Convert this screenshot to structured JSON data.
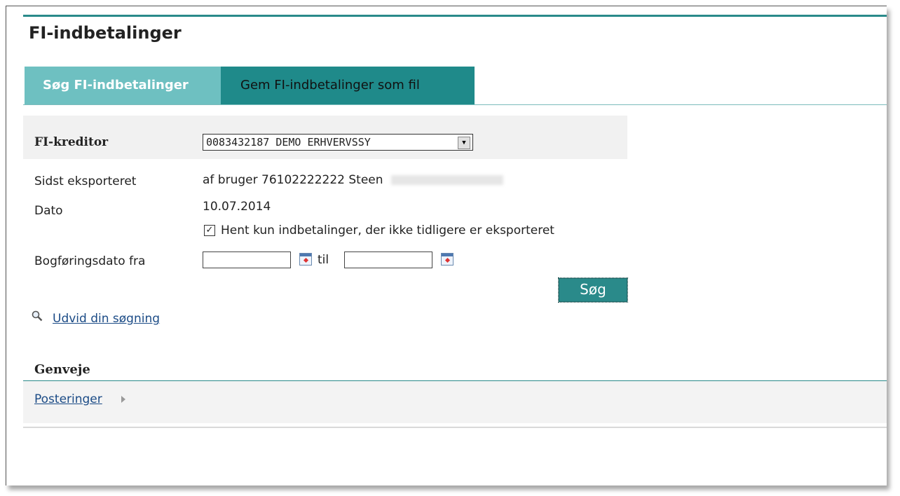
{
  "page": {
    "title": "FI-indbetalinger"
  },
  "tabs": [
    {
      "label": "Søg FI-indbetalinger",
      "active": true
    },
    {
      "label": "Gem FI-indbetalinger som fil",
      "active": false
    }
  ],
  "form": {
    "creditor_label": "FI-kreditor",
    "creditor_value": "0083432187 DEMO ERHVERVSSY",
    "last_exported_label": "Sidst eksporteret",
    "last_exported_value": "af bruger 76102222222 Steen",
    "date_label": "Dato",
    "date_value": "10.07.2014",
    "only_new_checked": true,
    "only_new_label": "Hent kun indbetalinger, der ikke tidligere er eksporteret",
    "posting_date_label": "Bogføringsdato fra",
    "date_from_value": "",
    "date_to_label": "til",
    "date_to_value": "",
    "search_button_label": "Søg"
  },
  "expand_search_link": "Udvid din søgning",
  "shortcuts": {
    "title": "Genveje",
    "items": [
      {
        "label": "Posteringer"
      }
    ]
  },
  "colors": {
    "accent": "#2a8a8a",
    "tab_active": "#6ec0c1",
    "link": "#1b4b86"
  }
}
